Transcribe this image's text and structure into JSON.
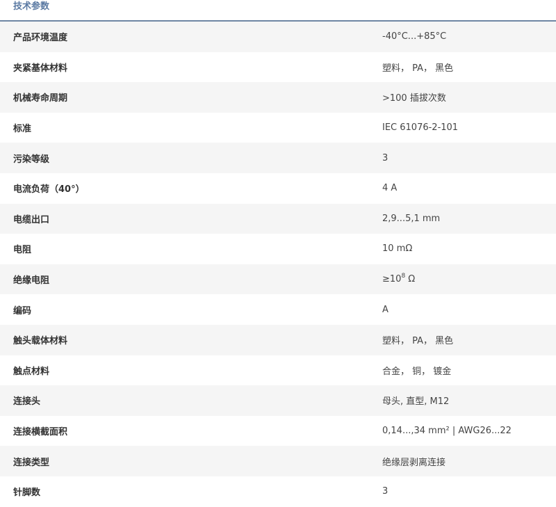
{
  "header": {
    "title": "技术参数"
  },
  "specs": [
    {
      "label": "产品环境温度",
      "value": "-40°C...+85°C"
    },
    {
      "label": "夹紧基体材料",
      "value": "塑料， PA， 黑色"
    },
    {
      "label": "机械寿命周期",
      "value": ">100 插拔次数"
    },
    {
      "label": "标准",
      "value": "IEC 61076-2-101"
    },
    {
      "label": "污染等级",
      "value": "3"
    },
    {
      "label": "电流负荷（40°）",
      "value": "4 A"
    },
    {
      "label": "电缆出口",
      "value": "2,9...5,1 mm"
    },
    {
      "label": "电阻",
      "value": "10 mΩ"
    },
    {
      "label": "绝缘电阻",
      "value_base": "≥10",
      "value_exp": "8",
      "value_unit": " Ω"
    },
    {
      "label": "编码",
      "value": "A"
    },
    {
      "label": "触头载体材料",
      "value": "塑料， PA， 黑色"
    },
    {
      "label": "触点材料",
      "value": "合金， 铜， 镀金"
    },
    {
      "label": "连接头",
      "value": "母头, 直型, M12"
    },
    {
      "label": "连接横截面积",
      "value": "0,14...,34 mm² | AWG26...22"
    },
    {
      "label": "连接类型",
      "value": "绝缘层剥离连接"
    },
    {
      "label": "针脚数",
      "value": "3"
    }
  ]
}
